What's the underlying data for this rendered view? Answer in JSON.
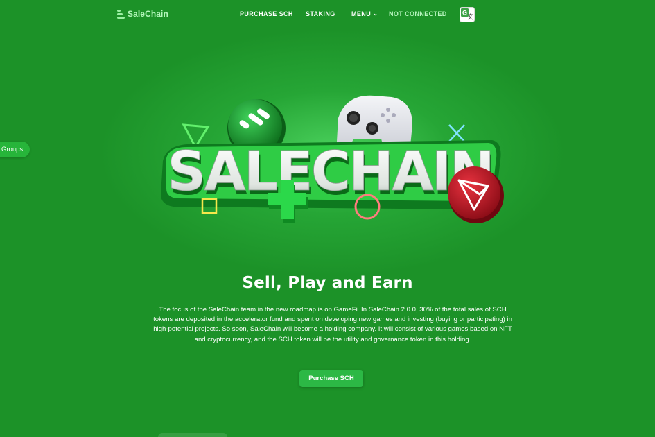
{
  "brand": {
    "name": "SaleChain",
    "accent": "#9bf0a3",
    "background": "#1c9228"
  },
  "nav": {
    "purchase": "PURCHASE SCH",
    "staking": "STAKING",
    "menu": "MENU",
    "wallet_status": "NOT CONNECTED",
    "translate_icon": "google-translate-icon"
  },
  "side_tab": {
    "label": "Groups"
  },
  "hero": {
    "logo_text": "SALECHAIN"
  },
  "content": {
    "headline": "Sell, Play and Earn",
    "description": "The focus of the SaleChain team in the new roadmap is on GameFi. In SaleChain 2.0.0, 30% of the total sales of SCH tokens are deposited in the accelerator fund and spent on developing new games and investing (buying or participating) in high-potential projects. So soon, SaleChain will become a holding company. It will consist of various games based on NFT and cryptocurrency, and the SCH token will be the utility and governance token in this holding.",
    "cta_label": "Purchase SCH"
  }
}
